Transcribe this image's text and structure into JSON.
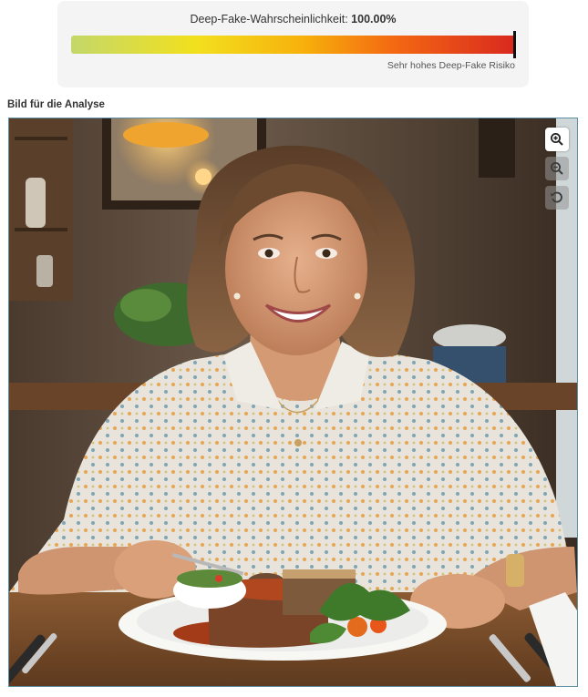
{
  "score": {
    "label": "Deep-Fake-Wahrscheinlichkeit:",
    "value": "100.00%",
    "fraction": 1.0,
    "risk_text": "Sehr hohes Deep-Fake Risiko"
  },
  "analysis": {
    "section_label": "Bild für die Analyse",
    "image_subject": "smiling woman eating meatloaf at a restaurant table"
  },
  "zoom_controls": {
    "zoom_in_icon": "zoom-in-icon",
    "zoom_out_icon": "zoom-out-icon",
    "reset_icon": "reset-rotate-icon"
  },
  "colors": {
    "bar_gradient_start": "#c3d86a",
    "bar_gradient_end": "#d9281f",
    "panel_background": "#f4f4f4",
    "frame_border": "#5e8fa6"
  }
}
